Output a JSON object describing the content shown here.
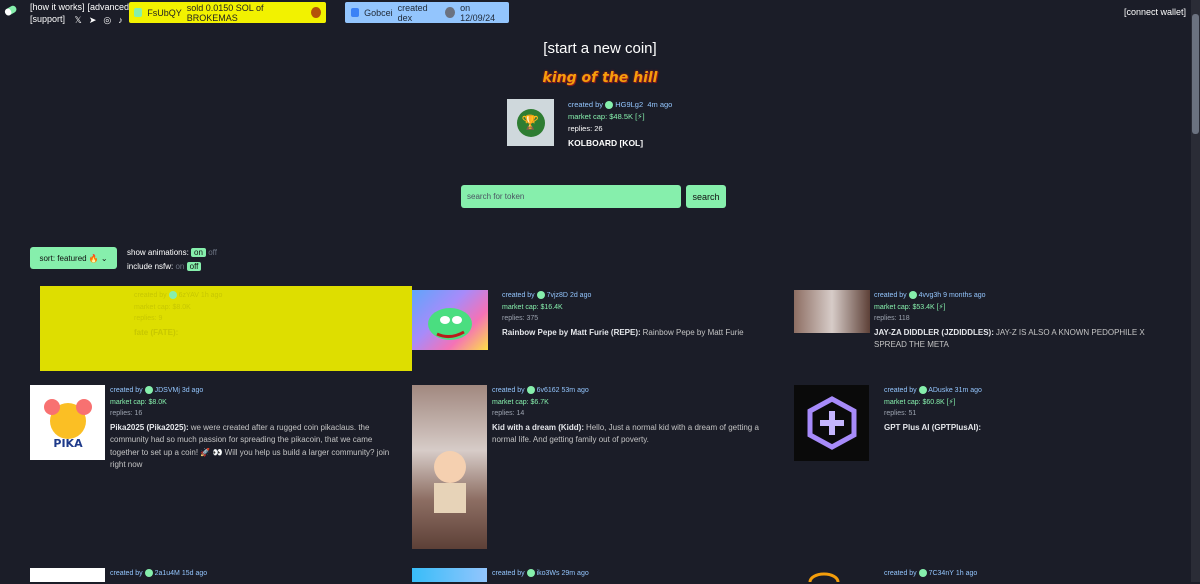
{
  "nav": {
    "how": "[how it works]",
    "advanced": "[advanced",
    "support": "[support]",
    "connect": "[connect wallet]"
  },
  "ticker1": {
    "user": "FsUbQY",
    "text": "sold 0.0150 SOL of BROKEMAS"
  },
  "ticker2": {
    "user": "Gobcei",
    "text": "created dex",
    "date": "on 12/09/24"
  },
  "hero": {
    "start": "[start a new coin]",
    "koth": "king of the hill"
  },
  "koth_coin": {
    "created_by": "created by",
    "creator": "HG9Lg2",
    "ago": "4m ago",
    "market_cap": "market cap: $48.5K",
    "bolt": "[⚡]",
    "replies": "replies: 26",
    "name": "KOLBOARD [KOL]"
  },
  "search": {
    "placeholder": "search for token",
    "button": "search"
  },
  "sort": {
    "label": "sort: featured 🔥"
  },
  "toggles": {
    "animations_label": "show animations:",
    "nsfw_label": "include nsfw:",
    "on": "on",
    "off": "off"
  },
  "coins": [
    {
      "creator": "6zYAV",
      "ago": "1h ago",
      "mcap": "market cap: $8.0K",
      "replies": "replies: 9",
      "title": "fate (FATE):",
      "desc": ""
    },
    {
      "creator": "7vjz8D",
      "ago": "2d ago",
      "mcap": "market cap: $16.4K",
      "replies": "replies: 375",
      "title": "Rainbow Pepe by Matt Furie (REPE):",
      "desc": "Rainbow Pepe by Matt Furie"
    },
    {
      "creator": "4vvg3h",
      "ago": "9 months ago",
      "mcap": "market cap: $53.4K",
      "bolt": "[⚡]",
      "replies": "replies: 118",
      "title": "JAY-ZA DIDDLER (JZDIDDLES):",
      "desc": "JAY-Z IS ALSO A KNOWN PEDOPHILE X SPREAD THE META"
    },
    {
      "creator": "JDSVMj",
      "ago": "3d ago",
      "mcap": "market cap: $8.0K",
      "replies": "replies: 16",
      "title": "Pika2025 (Pika2025):",
      "desc": "we were created after a rugged coin pikaclaus. the community had so much passion for spreading the pikacoin, that we came together to set up a coin! 🚀 👀 Will you help us build a larger community? join right now"
    },
    {
      "creator": "6v6162",
      "ago": "53m ago",
      "mcap": "market cap: $6.7K",
      "replies": "replies: 14",
      "title": "Kid with a dream (Kidd):",
      "desc": "Hello, Just a normal kid with a dream of getting a normal life. And getting family out of poverty."
    },
    {
      "creator": "ADuske",
      "ago": "31m ago",
      "mcap": "market cap: $60.8K",
      "bolt": "[⚡]",
      "replies": "replies: 51",
      "title": "GPT Plus AI (GPTPlusAI):",
      "desc": ""
    },
    {
      "creator": "2a1u4M",
      "ago": "15d ago"
    },
    {
      "creator": "iko3Ws",
      "ago": "29m ago"
    },
    {
      "creator": "7C34nY",
      "ago": "1h ago"
    }
  ],
  "labels": {
    "created_by": "created by"
  },
  "colors": {
    "bg": "#1b1d28",
    "accent": "#86efac",
    "ticker_yellow": "#f2f200",
    "ticker_blue": "#93c5fd",
    "flash_yellow": "#dede00"
  }
}
